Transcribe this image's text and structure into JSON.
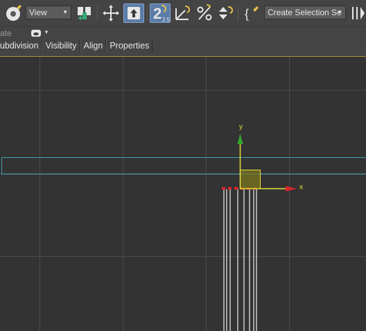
{
  "toolbar": {
    "view_dropdown": "View",
    "snap_number": "2",
    "snap_sub": "2.5",
    "selection_set_dropdown": "Create Selection Se",
    "braces_label": "{"
  },
  "row2": {
    "partial_label": "ate"
  },
  "tabs": [
    {
      "label": "ubdivision"
    },
    {
      "label": "Visibility"
    },
    {
      "label": "Align"
    },
    {
      "label": "Properties"
    }
  ],
  "viewport": {
    "axis_x_label": "x",
    "axis_y_label": "y",
    "colors": {
      "background": "#333333",
      "grid": "#4a4a4a",
      "selection_box": "#3fa2b4",
      "axis_y": "#2fa82f",
      "axis_x": "#d8262a",
      "gizmo": "#e8e13a",
      "gizmo_fill": "#7a7620"
    }
  }
}
